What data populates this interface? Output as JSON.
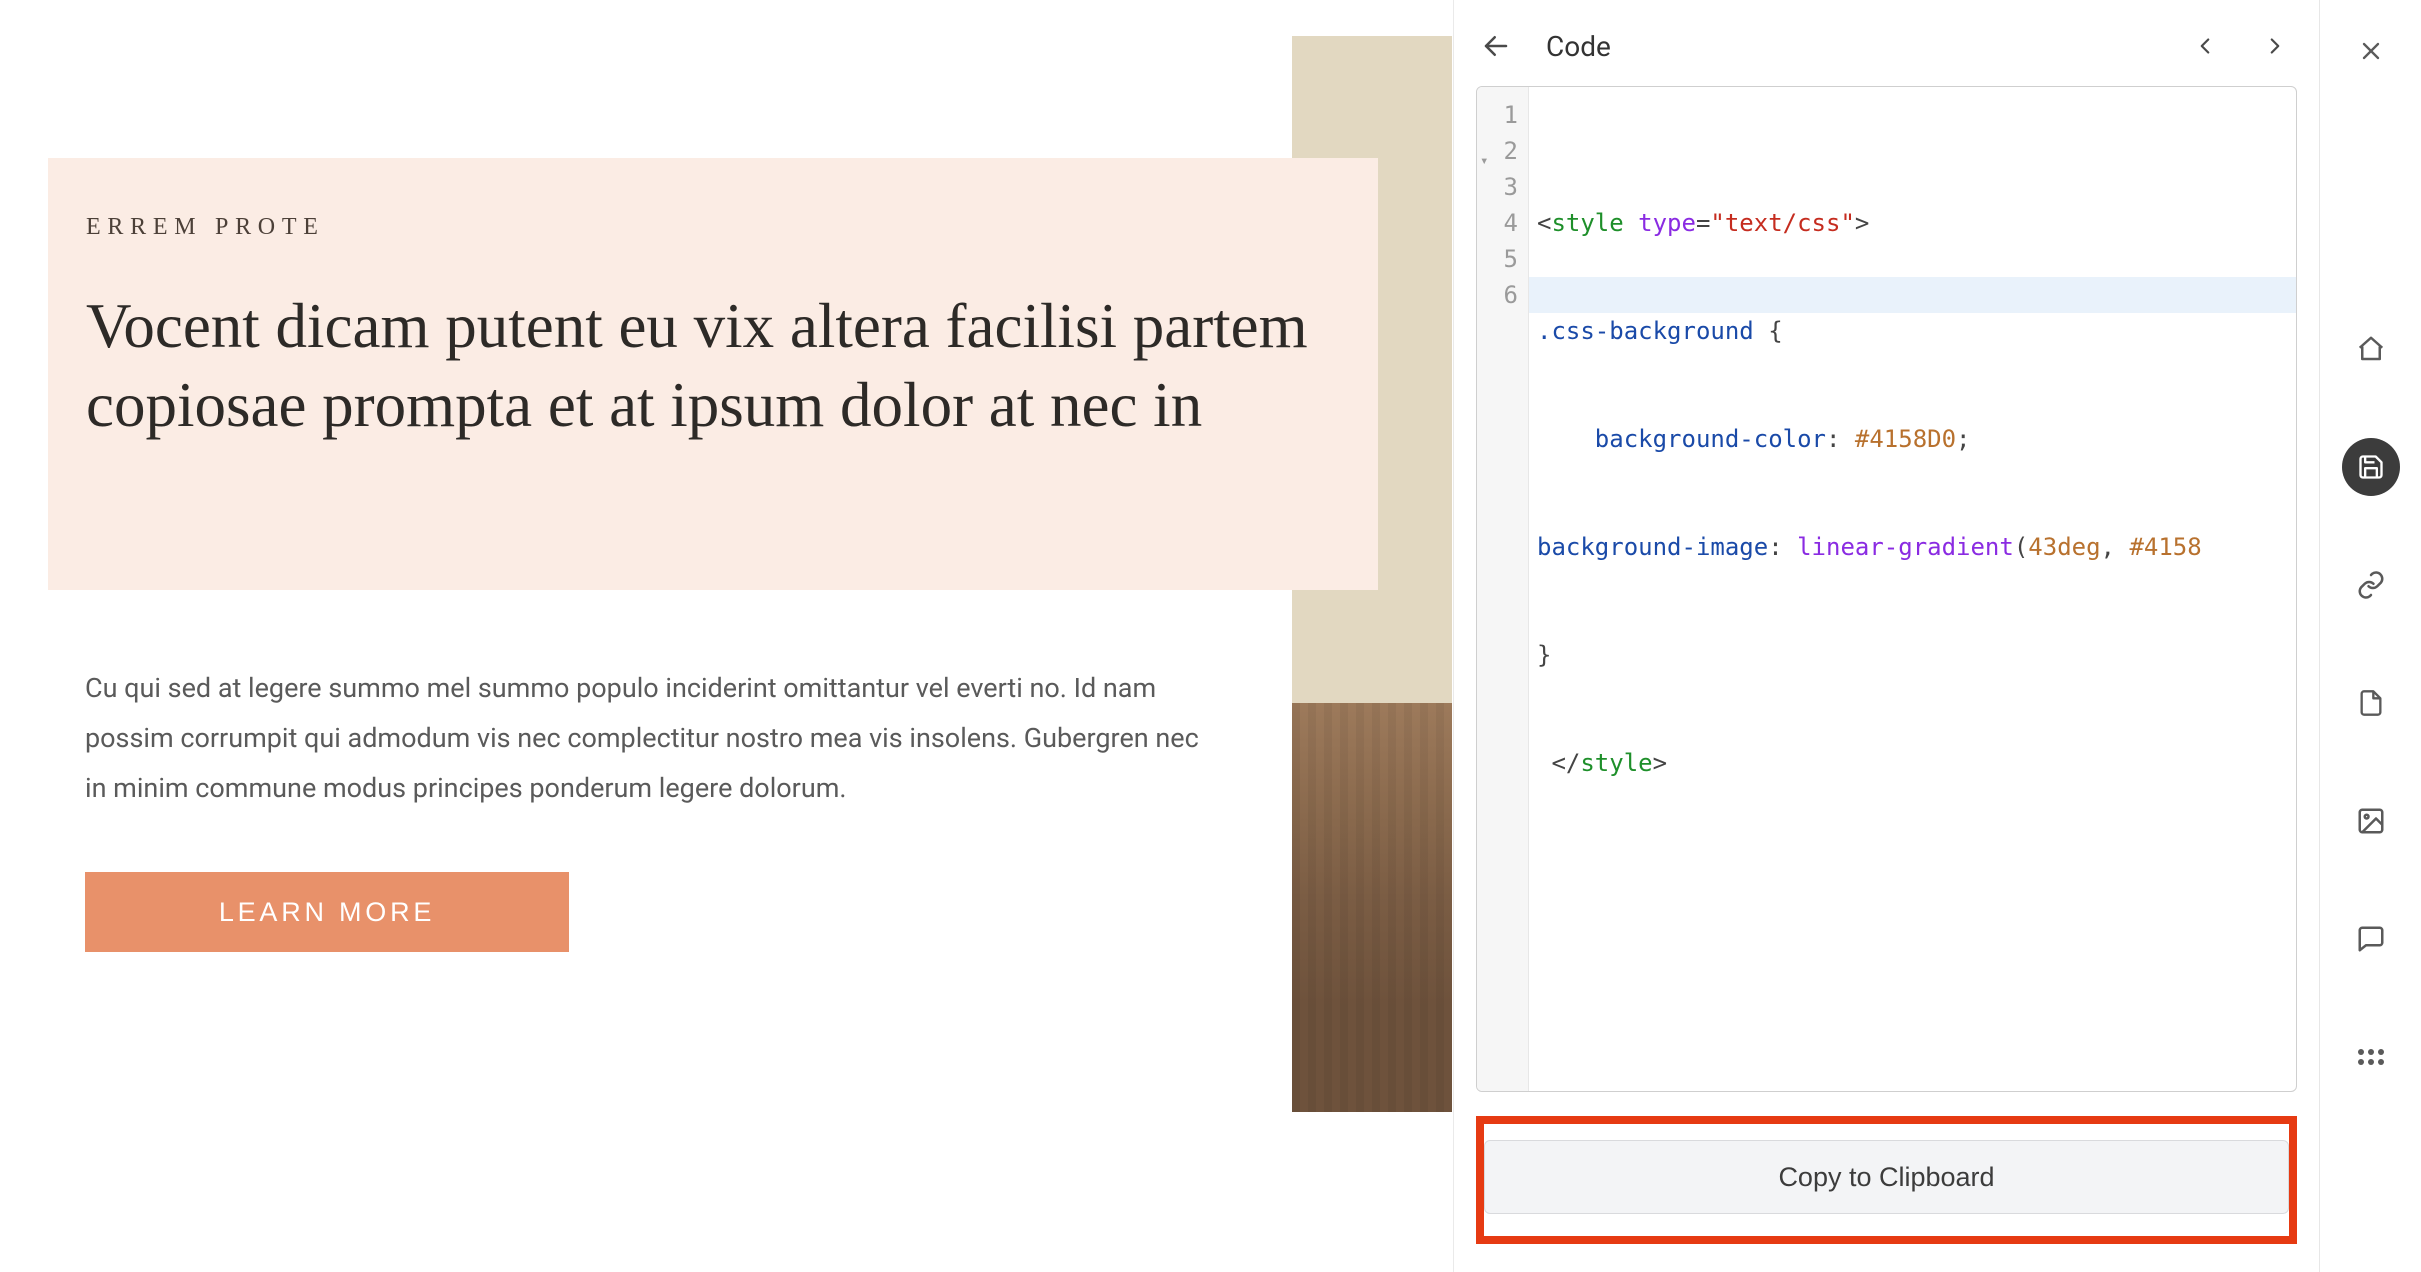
{
  "preview": {
    "eyebrow": "ERREM PROTE",
    "headline": "Vocent dicam putent eu vix altera facilisi partem copiosae prompta et at ipsum dolor at nec in",
    "body": "Cu qui sed at legere summo mel summo populo inciderint omittantur vel everti no. Id nam possim corrumpit qui admodum vis nec complectitur nostro mea vis insolens. Gubergren nec in minim commune modus principes ponderum legere dolorum.",
    "cta_label": "LEARN MORE"
  },
  "panel": {
    "title": "Code",
    "copy_button_label": "Copy to Clipboard",
    "highlight_color": "#e63a12"
  },
  "code": {
    "line_numbers": [
      "1",
      "2",
      "3",
      "4",
      "5",
      "6"
    ],
    "fold_at_line": 2,
    "active_line": 6,
    "tokens": {
      "l1_open": "<",
      "l1_tag": "style",
      "l1_space": " ",
      "l1_attr": "type",
      "l1_eq": "=",
      "l1_str": "\"text/css\"",
      "l1_close": ">",
      "l2_sel": ".css-background",
      "l2_brace": " {",
      "l3_indent": "    ",
      "l3_prop": "background-color",
      "l3_colon": ": ",
      "l3_val": "#4158D0",
      "l3_semi": ";",
      "l4_prop": "background-image",
      "l4_colon": ": ",
      "l4_func": "linear-gradient",
      "l4_args_open": "(",
      "l4_arg1": "43deg",
      "l4_comma": ", ",
      "l4_arg2": "#4158",
      "l5_brace": "}",
      "l6_open": " </",
      "l6_tag": "style",
      "l6_close": ">"
    },
    "raw_source": "<style type=\"text/css\">\n.css-background {\n    background-color: #4158D0;\nbackground-image: linear-gradient(43deg, #4158D0 ...);\n}\n</style>"
  },
  "rail": {
    "items": [
      {
        "name": "close-icon",
        "active": false
      },
      {
        "name": "home-icon",
        "active": false
      },
      {
        "name": "save-icon",
        "active": true
      },
      {
        "name": "link-icon",
        "active": false
      },
      {
        "name": "file-icon",
        "active": false
      },
      {
        "name": "image-icon",
        "active": false
      },
      {
        "name": "comment-icon",
        "active": false
      },
      {
        "name": "more-icon",
        "active": false
      }
    ]
  }
}
